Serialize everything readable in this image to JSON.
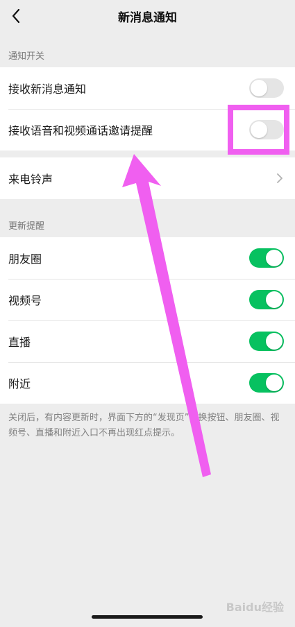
{
  "header": {
    "title": "新消息通知"
  },
  "sections": {
    "notify_switch": {
      "label": "通知开关",
      "items": [
        {
          "label": "接收新消息通知",
          "on": false
        },
        {
          "label": "接收语音和视频通话邀请提醒",
          "on": false
        }
      ]
    },
    "ringtone": {
      "label": "来电铃声"
    },
    "updates": {
      "label": "更新提醒",
      "items": [
        {
          "label": "朋友圈",
          "on": true
        },
        {
          "label": "视频号",
          "on": true
        },
        {
          "label": "直播",
          "on": true
        },
        {
          "label": "附近",
          "on": true
        }
      ]
    }
  },
  "footnote": "关闭后，有内容更新时，界面下方的“发现页”切换按钮、朋友圈、视频号、直播和附近入口不再出现红点提示。",
  "watermark": "Baidu经验",
  "colors": {
    "toggle_on": "#07c160",
    "toggle_off": "#e5e5e5",
    "annotation": "#f05ff0"
  },
  "icons": {
    "back": "chevron-left-icon",
    "ringtone": "chevron-right-icon"
  }
}
